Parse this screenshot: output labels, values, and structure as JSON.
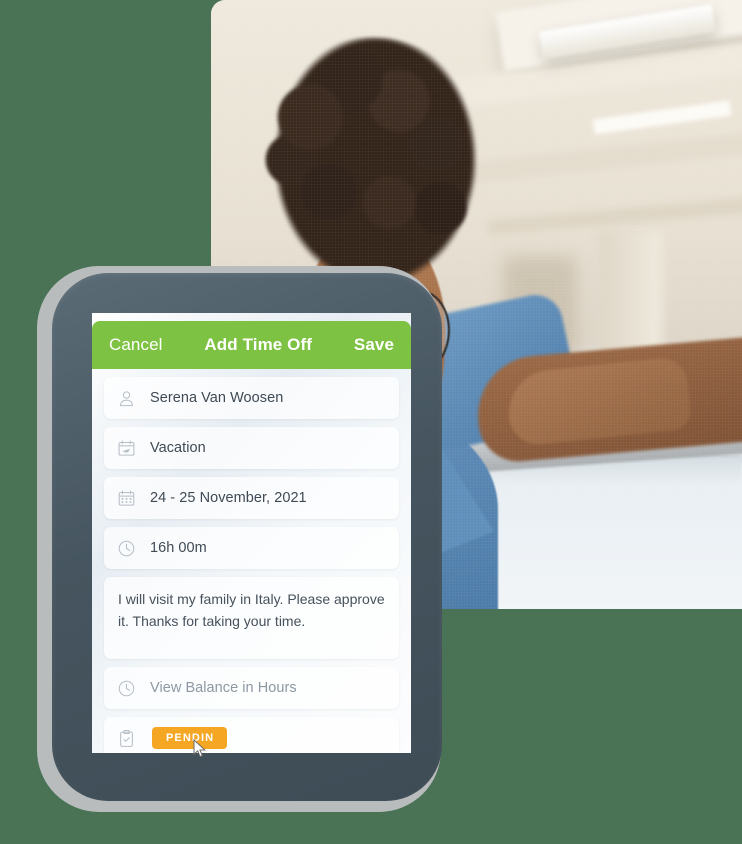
{
  "app": {
    "header": {
      "cancel_label": "Cancel",
      "title": "Add Time Off",
      "save_label": "Save",
      "background_color": "#7dc242"
    },
    "fields": [
      {
        "icon": "person-icon",
        "value": "Serena Van Woosen",
        "muted": false
      },
      {
        "icon": "vacation-plane-icon",
        "value": "Vacation",
        "muted": false
      },
      {
        "icon": "calendar-icon",
        "value": "24 - 25 November, 2021",
        "muted": false
      },
      {
        "icon": "clock-icon",
        "value": "16h 00m",
        "muted": false
      }
    ],
    "notes": {
      "text": "I will visit my family in Italy. Please approve it. Thanks for taking your time."
    },
    "balance": {
      "icon": "clock-icon",
      "label": "View Balance in Hours"
    },
    "status": {
      "icon": "clipboard-check-icon",
      "badge_label": "PENDIN",
      "badge_color": "#f5a623"
    }
  },
  "theme": {
    "page_background": "#4a7356",
    "phone_body": "#46555f",
    "phone_shadow": "#b9bcbd",
    "screen_background": "#ffffff",
    "text_primary": "#3f4a55",
    "text_muted": "#8d98a3"
  }
}
